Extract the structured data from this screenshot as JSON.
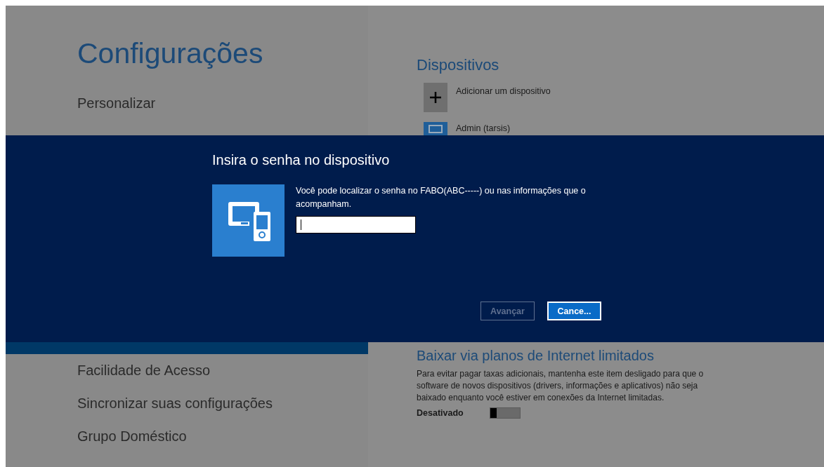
{
  "settings": {
    "title": "Configurações",
    "items": [
      {
        "label": "Personalizar",
        "selected": false
      },
      {
        "selected": true
      },
      {
        "label": "Facilidade de Acesso",
        "selected": false
      },
      {
        "label": "Sincronizar suas configurações",
        "selected": false
      },
      {
        "label": "Grupo Doméstico",
        "selected": false
      }
    ]
  },
  "devices": {
    "heading": "Dispositivos",
    "rows": [
      {
        "kind": "add",
        "label": "Adicionar um dispositivo"
      },
      {
        "kind": "device",
        "label": "Admin (tarsis)"
      }
    ],
    "metered": {
      "heading": "Baixar via planos de Internet limitados",
      "text": "Para evitar pagar taxas adicionais, mantenha este item desligado para que o software de novos dispositivos (drivers, informações e aplicativos) não seja baixado enquanto você estiver em conexões da Internet limitadas.",
      "toggle_label": "Desativado",
      "on": false
    }
  },
  "dialog": {
    "title": "Insira o senha no dispositivo",
    "message": "Você pode localizar o senha no FABO(ABC-----) ou nas informações que o acompanham.",
    "input": {
      "focused": true
    },
    "buttons": [
      {
        "label": "Avançar",
        "disabled": true,
        "default": false
      },
      {
        "label": "Cance...",
        "disabled": false,
        "default": true
      }
    ]
  }
}
